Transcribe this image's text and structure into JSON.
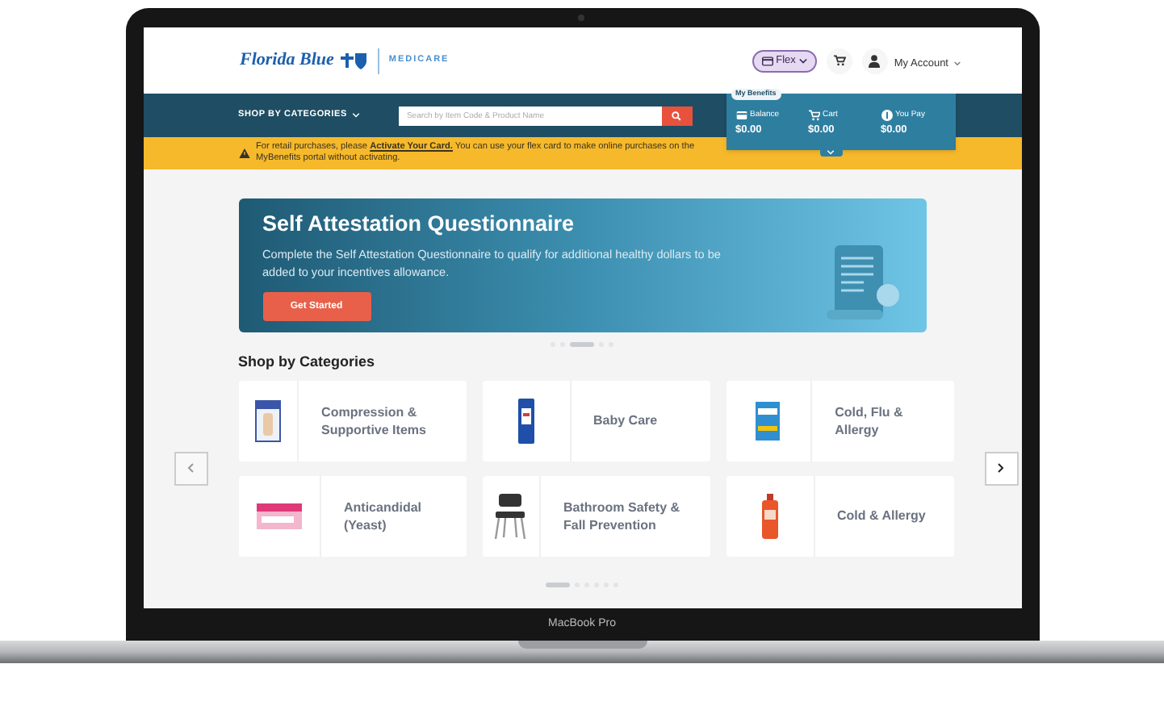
{
  "header": {
    "brand": "Florida Blue",
    "sub_brand": "MEDICARE",
    "flex_button": "Flex",
    "account": "My Account"
  },
  "nav": {
    "categories_menu": "SHOP BY CATEGORIES",
    "search": {
      "placeholder": "Search by Item Code & Product Name"
    }
  },
  "benefits_panel": {
    "title": "My Benefits",
    "items": [
      {
        "kind": "balance",
        "label": "Balance",
        "value": "$0.00"
      },
      {
        "kind": "cart",
        "label": "Cart",
        "value": "$0.00"
      },
      {
        "kind": "pay",
        "label": "You Pay",
        "value": "$0.00"
      }
    ]
  },
  "alert": {
    "text_before": "For retail purchases, please ",
    "link": "Activate Your Card.",
    "text_after": " You can use your flex card to make online purchases on the MyBenefits portal without activating."
  },
  "hero": {
    "title": "Self Attestation Questionnaire",
    "description": "Complete the Self Attestation Questionnaire to qualify for additional healthy dollars to be added to your incentives allowance.",
    "button": "Get Started",
    "dots": [
      {
        "selected": false
      },
      {
        "selected": false
      },
      {
        "selected": true
      },
      {
        "selected": false
      },
      {
        "selected": false
      }
    ]
  },
  "categories": {
    "title": "Shop by Categories",
    "items": [
      {
        "kind": "brace",
        "label": "Compression & Supportive Items"
      },
      {
        "kind": "baby",
        "label": "Baby Care"
      },
      {
        "kind": "cold",
        "label": "Cold, Flu & Allergy"
      },
      {
        "kind": "cream",
        "label": "Anticandidal (Yeast)"
      },
      {
        "kind": "chair",
        "label": "Bathroom Safety & Fall Prevention"
      },
      {
        "kind": "syrup",
        "label": "Cold & Allergy"
      }
    ],
    "dots": [
      {
        "selected": true
      },
      {
        "selected": false
      },
      {
        "selected": false
      },
      {
        "selected": false
      },
      {
        "selected": false
      },
      {
        "selected": false
      }
    ]
  },
  "laptop": {
    "label": "MacBook Pro"
  }
}
